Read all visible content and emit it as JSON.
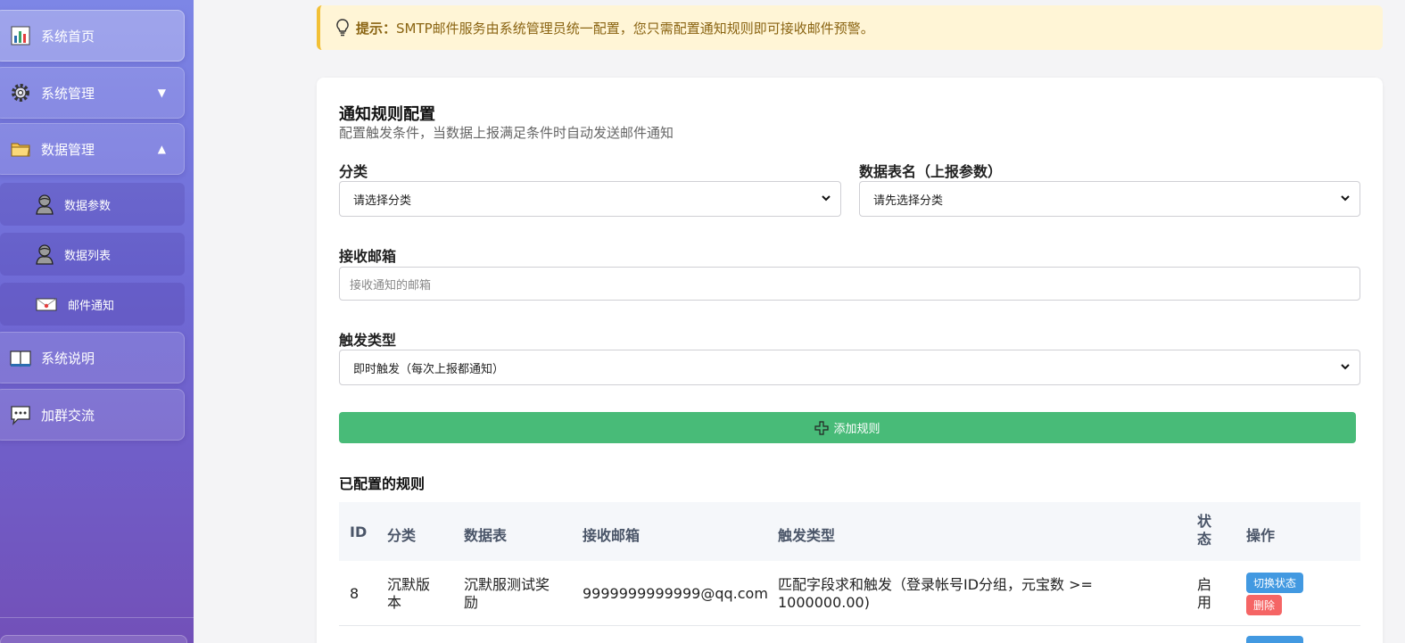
{
  "sidebar": {
    "items": [
      {
        "label": "系统首页",
        "icon": "chart-icon"
      },
      {
        "label": "系统管理",
        "icon": "gear-icon",
        "chevron": "▼"
      },
      {
        "label": "数据管理",
        "icon": "folder-icon",
        "chevron": "▲"
      },
      {
        "label": "系统说明",
        "icon": "book-icon"
      },
      {
        "label": "加群交流",
        "icon": "chat-icon"
      }
    ],
    "sub_items": [
      {
        "label": "数据参数",
        "icon": "user-icon"
      },
      {
        "label": "数据列表",
        "icon": "user-icon"
      },
      {
        "label": "邮件通知",
        "icon": "envelope-icon"
      }
    ]
  },
  "tip": {
    "prefix": "提示：",
    "text": "SMTP邮件服务由系统管理员统一配置，您只需配置通知规则即可接收邮件预警。"
  },
  "form": {
    "title": "通知规则配置",
    "subtitle": "配置触发条件，当数据上报满足条件时自动发送邮件通知",
    "category_label": "分类",
    "category_value": "请选择分类",
    "table_label": "数据表名（上报参数）",
    "table_value": "请先选择分类",
    "email_label": "接收邮箱",
    "email_placeholder": "接收通知的邮箱",
    "trigger_label": "触发类型",
    "trigger_value": "即时触发（每次上报都通知）",
    "add_button": "添加规则"
  },
  "rules": {
    "title": "已配置的规则",
    "headers": [
      "ID",
      "分类",
      "数据表",
      "接收邮箱",
      "触发类型",
      "状态",
      "操作"
    ],
    "rows": [
      {
        "id": "8",
        "category": "沉默版本",
        "table": "沉默服测试奖励",
        "email": "9999999999999@qq.com",
        "trigger": "匹配字段求和触发（登录帐号ID分组，元宝数 >= 1000000.00)",
        "status": "启用",
        "toggle": "切换状态",
        "delete": "删除"
      }
    ]
  },
  "colors": {
    "sidebar_top": "#7d86e6",
    "sidebar_bottom": "#7250b8",
    "tip_bg": "#fff5d6",
    "tip_border": "#f2c037",
    "add_button": "#48bb78",
    "toggle_button": "#4299e1",
    "delete_button": "#f56565"
  }
}
